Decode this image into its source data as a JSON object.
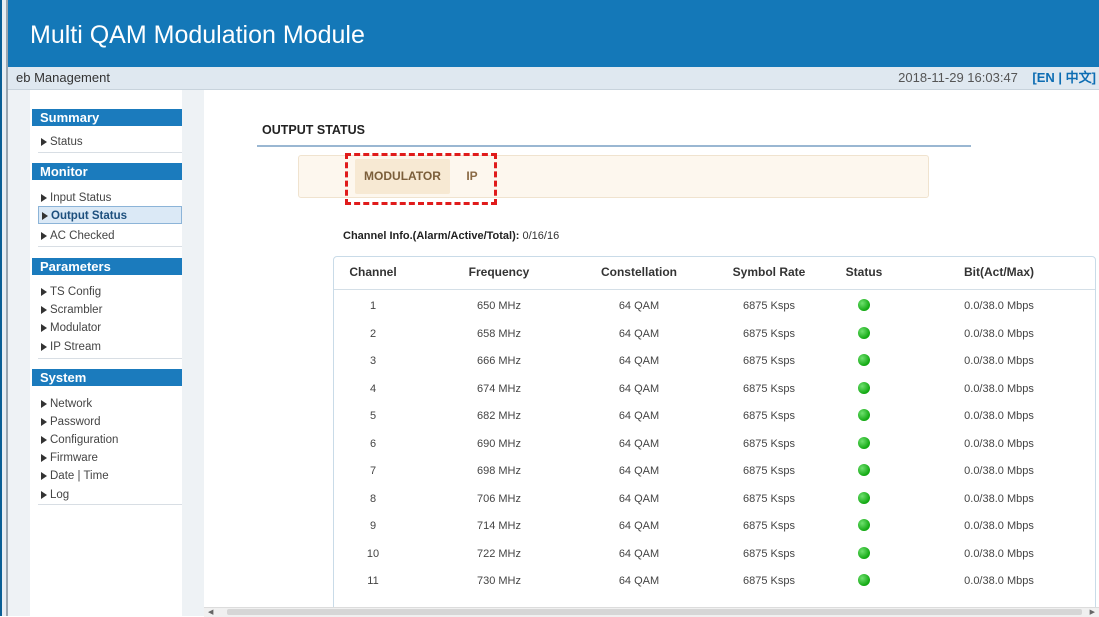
{
  "header": {
    "title": "Multi QAM Modulation Module"
  },
  "subbar": {
    "breadcrumb": "eb Management",
    "datetime": "2018-11-29 16:03:47",
    "lang_open": "[",
    "lang_en": "EN",
    "lang_sep": " | ",
    "lang_zh": "中文",
    "lang_close": "]"
  },
  "sidebar": {
    "sections": [
      {
        "title": "Summary",
        "items": [
          "Status"
        ]
      },
      {
        "title": "Monitor",
        "items": [
          "Input Status",
          "Output Status",
          "AC Checked"
        ]
      },
      {
        "title": "Parameters",
        "items": [
          "TS Config",
          "Scrambler",
          "Modulator",
          "IP Stream"
        ]
      },
      {
        "title": "System",
        "items": [
          "Network",
          "Password",
          "Configuration",
          "Firmware",
          "Date | Time",
          "Log"
        ]
      }
    ],
    "active_item": "Output Status"
  },
  "main": {
    "title": "OUTPUT STATUS",
    "tabs": [
      {
        "label": "MODULATOR",
        "active": true
      },
      {
        "label": "IP",
        "active": false
      }
    ],
    "channel_info_label": "Channel Info.(Alarm/Active/Total):",
    "channel_info_value": "0/16/16"
  },
  "table": {
    "columns": [
      "Channel",
      "Frequency",
      "Constellation",
      "Symbol Rate",
      "Status",
      "Bit(Act/Max)"
    ],
    "rows": [
      {
        "channel": "1",
        "frequency": "650 MHz",
        "constellation": "64 QAM",
        "symbol_rate": "6875 Ksps",
        "status": "ok",
        "bit": "0.0/38.0 Mbps"
      },
      {
        "channel": "2",
        "frequency": "658 MHz",
        "constellation": "64 QAM",
        "symbol_rate": "6875 Ksps",
        "status": "ok",
        "bit": "0.0/38.0 Mbps"
      },
      {
        "channel": "3",
        "frequency": "666 MHz",
        "constellation": "64 QAM",
        "symbol_rate": "6875 Ksps",
        "status": "ok",
        "bit": "0.0/38.0 Mbps"
      },
      {
        "channel": "4",
        "frequency": "674 MHz",
        "constellation": "64 QAM",
        "symbol_rate": "6875 Ksps",
        "status": "ok",
        "bit": "0.0/38.0 Mbps"
      },
      {
        "channel": "5",
        "frequency": "682 MHz",
        "constellation": "64 QAM",
        "symbol_rate": "6875 Ksps",
        "status": "ok",
        "bit": "0.0/38.0 Mbps"
      },
      {
        "channel": "6",
        "frequency": "690 MHz",
        "constellation": "64 QAM",
        "symbol_rate": "6875 Ksps",
        "status": "ok",
        "bit": "0.0/38.0 Mbps"
      },
      {
        "channel": "7",
        "frequency": "698 MHz",
        "constellation": "64 QAM",
        "symbol_rate": "6875 Ksps",
        "status": "ok",
        "bit": "0.0/38.0 Mbps"
      },
      {
        "channel": "8",
        "frequency": "706 MHz",
        "constellation": "64 QAM",
        "symbol_rate": "6875 Ksps",
        "status": "ok",
        "bit": "0.0/38.0 Mbps"
      },
      {
        "channel": "9",
        "frequency": "714 MHz",
        "constellation": "64 QAM",
        "symbol_rate": "6875 Ksps",
        "status": "ok",
        "bit": "0.0/38.0 Mbps"
      },
      {
        "channel": "10",
        "frequency": "722 MHz",
        "constellation": "64 QAM",
        "symbol_rate": "6875 Ksps",
        "status": "ok",
        "bit": "0.0/38.0 Mbps"
      },
      {
        "channel": "11",
        "frequency": "730 MHz",
        "constellation": "64 QAM",
        "symbol_rate": "6875 Ksps",
        "status": "ok",
        "bit": "0.0/38.0 Mbps"
      }
    ]
  },
  "colors": {
    "banner": "#1478b8",
    "section_header": "#1b7bbd",
    "status_ok": "#11a811",
    "highlight_box": "#e01b1b"
  }
}
